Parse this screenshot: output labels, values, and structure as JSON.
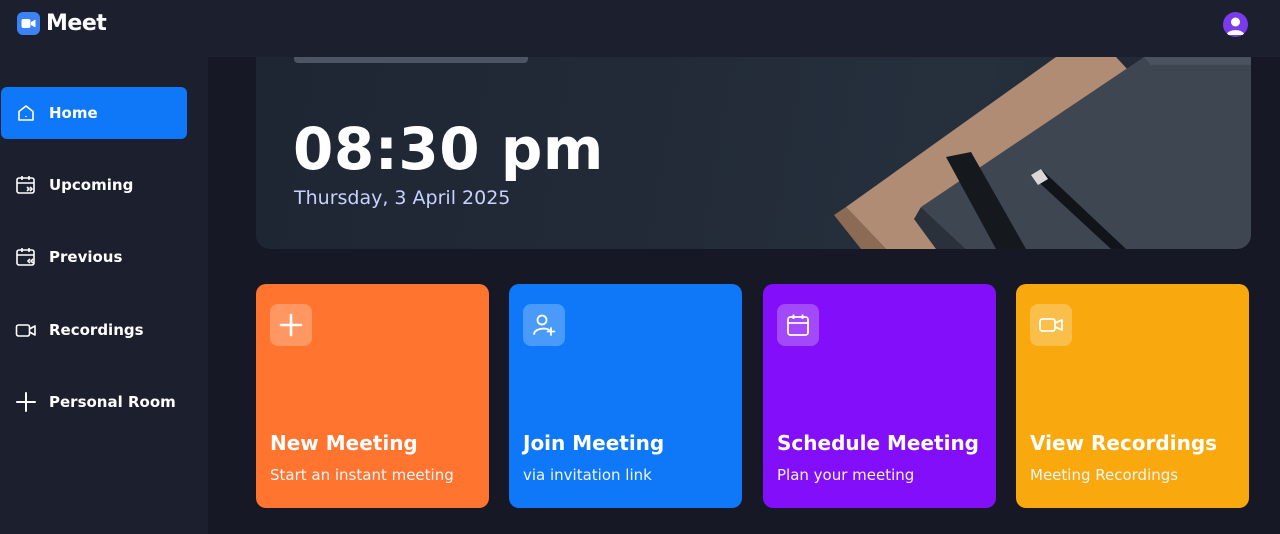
{
  "app": {
    "logo_icon": "video-camera-icon",
    "title": "Meet",
    "avatar_icon": "user-avatar-icon"
  },
  "sidebar": {
    "items": [
      {
        "label": "Home",
        "icon": "home-icon",
        "active": true
      },
      {
        "label": "Upcoming",
        "icon": "calendar-forward-icon",
        "active": false
      },
      {
        "label": "Previous",
        "icon": "calendar-back-icon",
        "active": false
      },
      {
        "label": "Recordings",
        "icon": "video-icon",
        "active": false
      },
      {
        "label": "Personal Room",
        "icon": "plus-icon",
        "active": false
      }
    ]
  },
  "hero": {
    "time": "08:30 pm",
    "date": "Thursday, 3 April 2025"
  },
  "cards": [
    {
      "title": "New Meeting",
      "subtitle": "Start an instant meeting",
      "icon": "plus-icon",
      "color": "#ff742e"
    },
    {
      "title": "Join Meeting",
      "subtitle": "via invitation link",
      "icon": "user-add-icon",
      "color": "#0e78f9"
    },
    {
      "title": "Schedule Meeting",
      "subtitle": "Plan your meeting",
      "icon": "calendar-icon",
      "color": "#830ef9"
    },
    {
      "title": "View Recordings",
      "subtitle": "Meeting Recordings",
      "icon": "video-icon",
      "color": "#f9a90e"
    }
  ],
  "colors": {
    "background": "#161925",
    "panel": "#1c1f2e",
    "accent": "#0e78f9"
  }
}
